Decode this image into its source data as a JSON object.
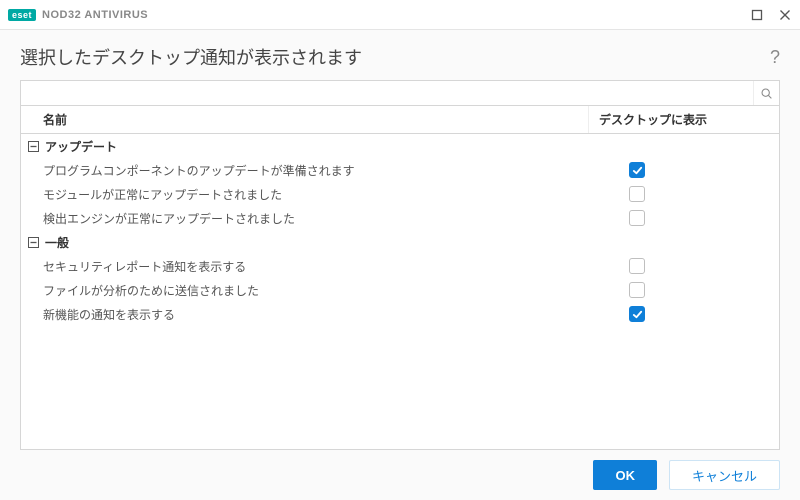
{
  "brand": {
    "badge": "eset",
    "product": "NOD32 ANTIVIRUS"
  },
  "page": {
    "title": "選択したデスクトップ通知が表示されます",
    "help": "?"
  },
  "search": {
    "placeholder": ""
  },
  "columns": {
    "name": "名前",
    "desktop": "デスクトップに表示"
  },
  "groups": [
    {
      "label": "アップデート",
      "items": [
        {
          "label": "プログラムコンポーネントのアップデートが準備されます",
          "checked": true
        },
        {
          "label": "モジュールが正常にアップデートされました",
          "checked": false
        },
        {
          "label": "検出エンジンが正常にアップデートされました",
          "checked": false
        }
      ]
    },
    {
      "label": "一般",
      "items": [
        {
          "label": "セキュリティレポート通知を表示する",
          "checked": false
        },
        {
          "label": "ファイルが分析のために送信されました",
          "checked": false
        },
        {
          "label": "新機能の通知を表示する",
          "checked": true
        }
      ]
    }
  ],
  "footer": {
    "ok": "OK",
    "cancel": "キャンセル"
  }
}
